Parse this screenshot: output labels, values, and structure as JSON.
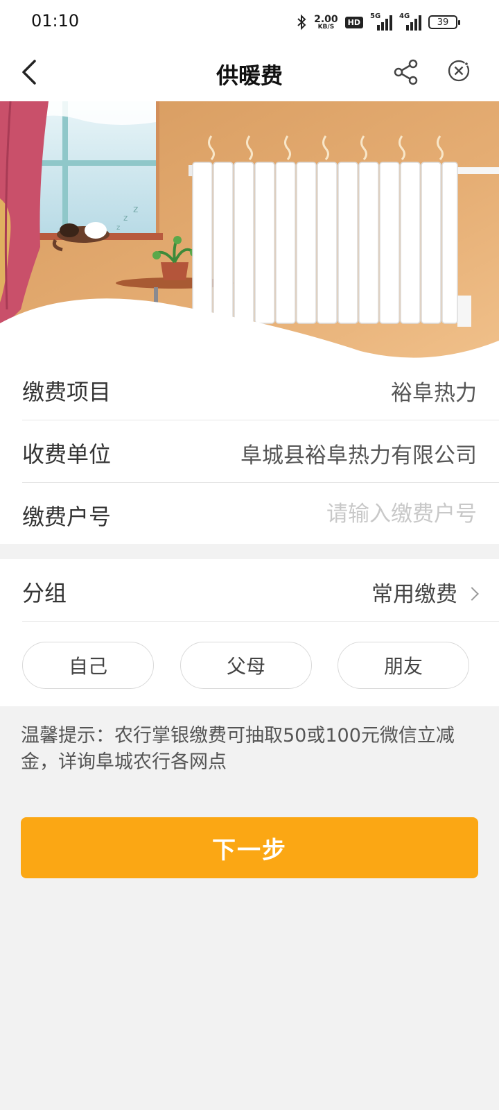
{
  "status_bar": {
    "time": "01:10",
    "net_speed_value": "2.00",
    "net_speed_unit": "KB/S",
    "hd_badge": "HD",
    "signal1_label": "5G",
    "signal2_label": "4G",
    "battery": "39"
  },
  "nav": {
    "title": "供暖费",
    "icons": [
      "back-arrow-icon",
      "share-icon",
      "close-icon"
    ]
  },
  "form": {
    "item_label": "缴费项目",
    "item_value": "裕阜热力",
    "unit_label": "收费单位",
    "unit_value": "阜城县裕阜热力有限公司",
    "account_label": "缴费户号",
    "account_value": "",
    "account_placeholder": "请输入缴费户号"
  },
  "group": {
    "label": "分组",
    "value": "常用缴费",
    "options": [
      "自己",
      "父母",
      "朋友"
    ]
  },
  "tip": "温馨提示：农行掌银缴费可抽取50或100元微信立减金，详询阜城农行各网点",
  "next_button": "下一步",
  "colors": {
    "accent": "#fba714",
    "page_bg": "#f2f2f2"
  }
}
